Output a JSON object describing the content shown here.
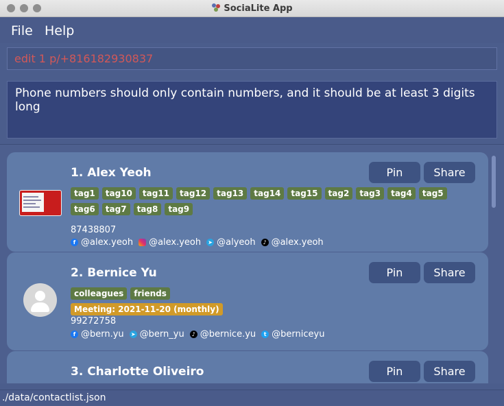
{
  "window": {
    "title": "SociaLite App"
  },
  "menu": {
    "file": "File",
    "help": "Help"
  },
  "command": {
    "value": "edit 1 p/+816182930837"
  },
  "result": {
    "text": "Phone numbers should only contain numbers, and it should be at least 3 digits long"
  },
  "contacts": [
    {
      "index_name": "1.  Alex Yeoh",
      "pin_label": "Pin",
      "share_label": "Share",
      "tags": [
        "tag1",
        "tag10",
        "tag11",
        "tag12",
        "tag13",
        "tag14",
        "tag15",
        "tag2",
        "tag3",
        "tag4",
        "tag5",
        "tag6",
        "tag7",
        "tag8",
        "tag9"
      ],
      "phone": "87438807",
      "socials": {
        "facebook": "@alex.yeoh",
        "instagram": "@alex.yeoh",
        "telegram": "@alyeoh",
        "tiktok": "@alex.yeoh"
      }
    },
    {
      "index_name": "2.  Bernice Yu",
      "pin_label": "Pin",
      "share_label": "Share",
      "tags": [
        "colleagues",
        "friends"
      ],
      "meeting": "Meeting: 2021-11-20 (monthly)",
      "phone": "99272758",
      "socials": {
        "facebook": "@bern.yu",
        "telegram": "@bern_yu",
        "tiktok": "@bernice.yu",
        "twitter": "@berniceyu"
      }
    },
    {
      "index_name": "3.  Charlotte Oliveiro",
      "pin_label": "Pin",
      "share_label": "Share"
    }
  ],
  "icons": {
    "facebook": "facebook-icon",
    "instagram": "instagram-icon",
    "telegram": "telegram-icon",
    "tiktok": "tiktok-icon",
    "twitter": "twitter-icon"
  },
  "status": {
    "path": "./data/contactlist.json"
  }
}
